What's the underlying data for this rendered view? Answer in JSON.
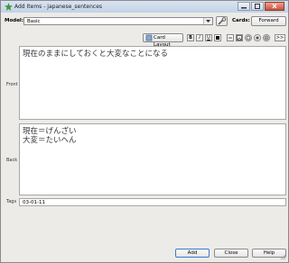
{
  "window": {
    "title": "Add Items - japanese_sentences"
  },
  "model": {
    "label": "Model:",
    "value": "Basic"
  },
  "cards": {
    "label": "Cards:",
    "value": "Forward"
  },
  "toolbar": {
    "card_layout": "Card Layout",
    "bold": "B",
    "italic": "I",
    "underline": "U",
    "more": ">>"
  },
  "fields": {
    "front": {
      "label": "Front",
      "value": "現在のままにしておくと大変なことになる"
    },
    "back": {
      "label": "Back",
      "value": "現在＝げんざい\n大変＝たいへん"
    }
  },
  "tags": {
    "label": "Tags",
    "value": "03-01-11"
  },
  "buttons": {
    "add": "Add",
    "close": "Close",
    "help": "Help"
  }
}
